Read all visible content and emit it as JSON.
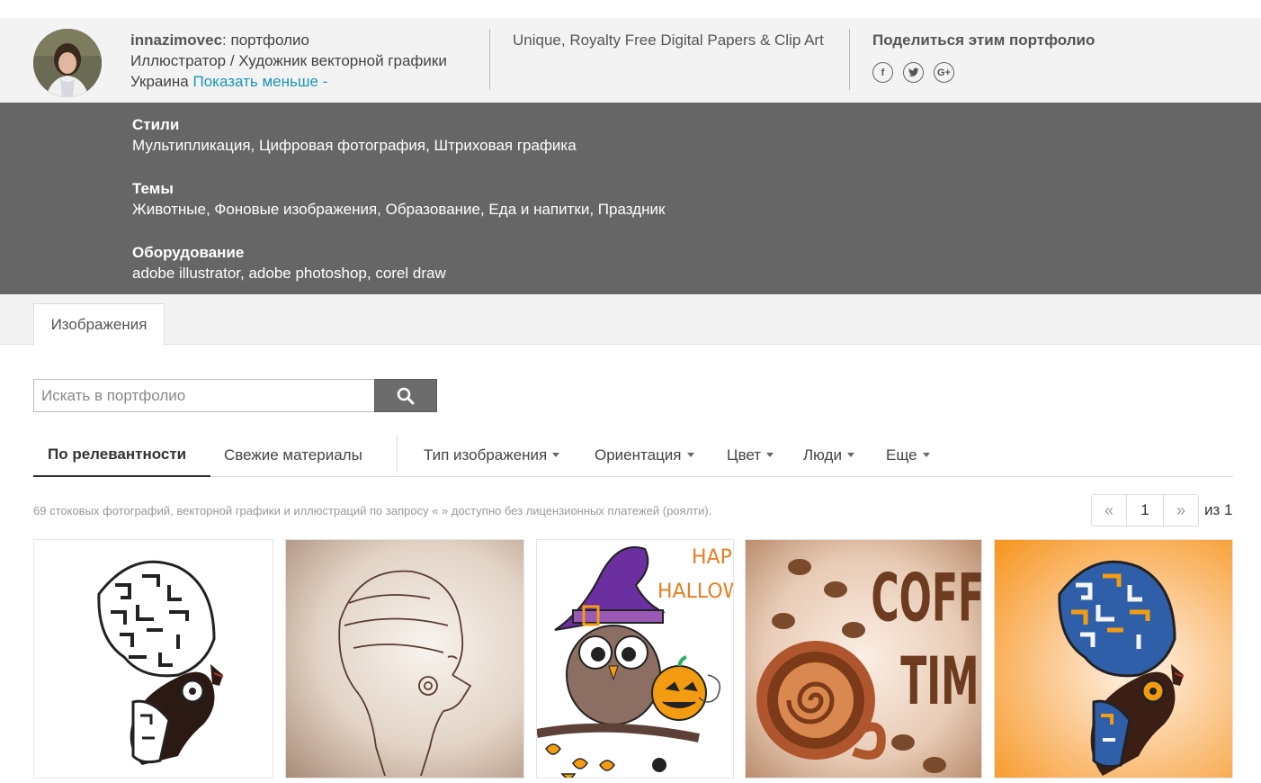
{
  "profile": {
    "username": "innazimovec",
    "title_suffix": ": портфолио",
    "role": "Иллюстратор / Художник векторной графики",
    "country": "Украина",
    "toggle_link": "Показать меньше -",
    "tagline": "Unique, Royalty Free Digital Papers & Clip Art"
  },
  "share": {
    "title": "Поделиться этим портфолио",
    "icons": [
      "facebook-icon",
      "twitter-icon",
      "google-plus-icon"
    ]
  },
  "details": {
    "styles_heading": "Стили",
    "styles_value": "Мультипликация, Цифровая фотография, Штриховая графика",
    "themes_heading": "Темы",
    "themes_value": "Животные, Фоновые изображения, Образование, Еда и напитки, Праздник",
    "equipment_heading": "Оборудование",
    "equipment_value": "adobe illustrator, adobe photoshop, corel draw"
  },
  "tabs": {
    "images": "Изображения"
  },
  "search": {
    "placeholder": "Искать в портфолио",
    "button_icon": "search-icon"
  },
  "sort": {
    "relevance": "По релевантности",
    "fresh": "Свежие материалы"
  },
  "filters": {
    "type": "Тип изображения",
    "orientation": "Ориентация",
    "color": "Цвет",
    "people": "Люди",
    "more": "Еще"
  },
  "results": {
    "text": "69 стоковых фотографий, векторной графики и иллюстраций по запросу « » доступно без лицензионных платежей (роялти)."
  },
  "pager": {
    "prev": "«",
    "current": "1",
    "next": "»",
    "of_label": "из",
    "total": "1"
  },
  "thumbnails": {
    "halloween_text_1": "HAPPY",
    "halloween_text_2": "HALLOWEEN",
    "coffee_text_1": "COFFEE",
    "coffee_text_2": "TIME"
  },
  "colors": {
    "accent_link": "#1b95b7",
    "details_bg": "#666666",
    "header_bg": "#f3f3f3",
    "orange_bg": "#f7941d"
  }
}
